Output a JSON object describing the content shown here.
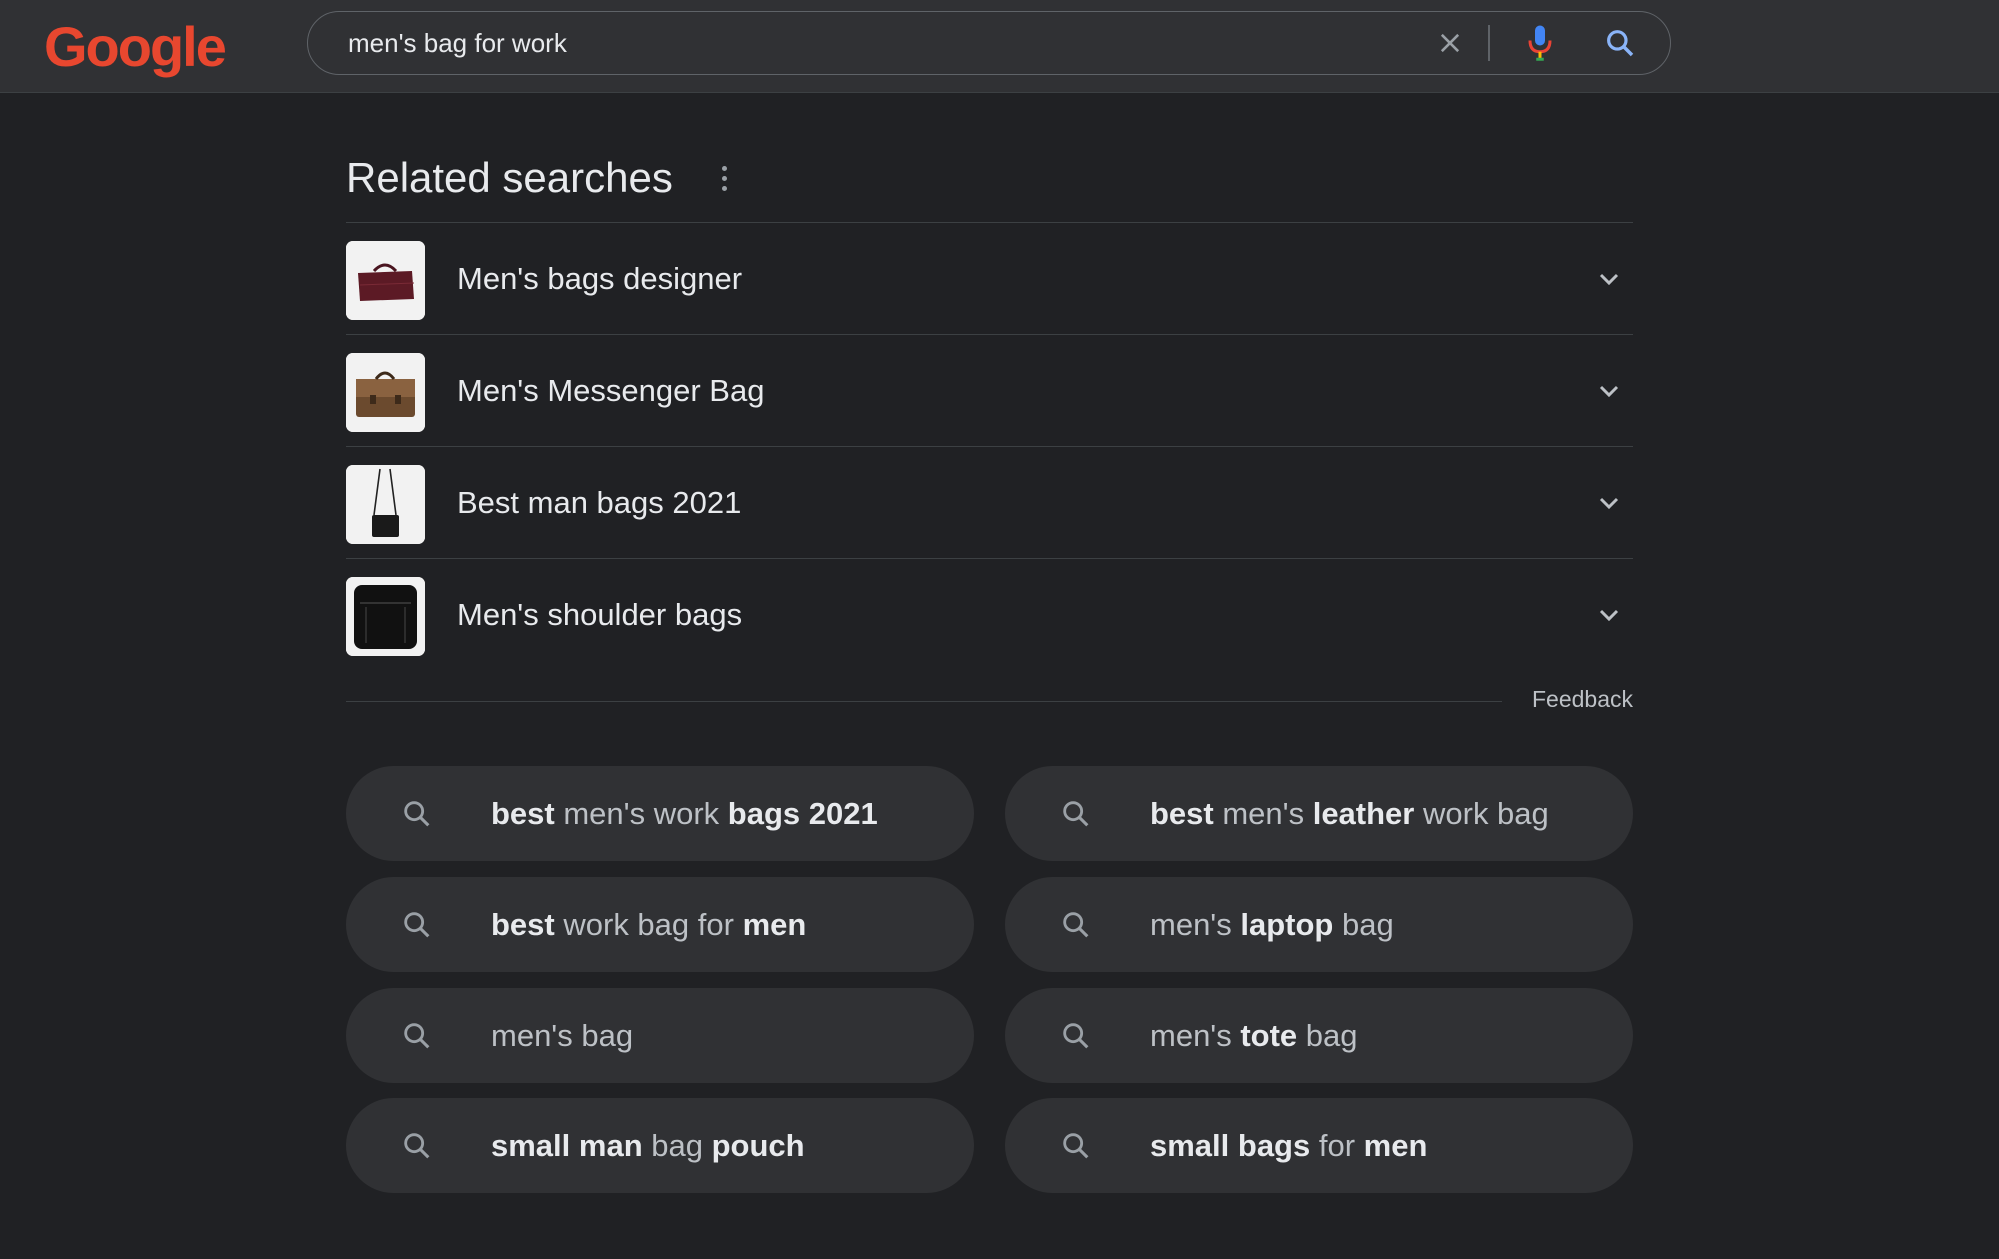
{
  "header": {
    "logo_text": "Google",
    "search_query": "men's bag for work",
    "icons": {
      "clear": "close-icon",
      "voice": "mic-icon",
      "search": "search-icon"
    }
  },
  "related": {
    "heading": "Related searches",
    "items": [
      {
        "label": "Men's bags designer",
        "thumb": "maroon-briefcase"
      },
      {
        "label": "Men's Messenger Bag",
        "thumb": "brown-messenger"
      },
      {
        "label": "Best man bags 2021",
        "thumb": "black-crossbody"
      },
      {
        "label": "Men's shoulder bags",
        "thumb": "black-shoulder-bag"
      }
    ],
    "feedback": "Feedback"
  },
  "chips": [
    {
      "parts": [
        {
          "t": "best",
          "b": true
        },
        {
          "t": " men's work ",
          "b": false
        },
        {
          "t": "bags 2021",
          "b": true
        }
      ]
    },
    {
      "parts": [
        {
          "t": "best",
          "b": true
        },
        {
          "t": " men's ",
          "b": false
        },
        {
          "t": "leather",
          "b": true
        },
        {
          "t": " work bag",
          "b": false
        }
      ]
    },
    {
      "parts": [
        {
          "t": "best",
          "b": true
        },
        {
          "t": " work bag for ",
          "b": false
        },
        {
          "t": "men",
          "b": true
        }
      ]
    },
    {
      "parts": [
        {
          "t": "men's ",
          "b": false
        },
        {
          "t": "laptop",
          "b": true
        },
        {
          "t": " bag",
          "b": false
        }
      ]
    },
    {
      "parts": [
        {
          "t": "men's bag",
          "b": false
        }
      ]
    },
    {
      "parts": [
        {
          "t": "men's ",
          "b": false
        },
        {
          "t": "tote",
          "b": true
        },
        {
          "t": " bag",
          "b": false
        }
      ]
    },
    {
      "parts": [
        {
          "t": "small man",
          "b": true
        },
        {
          "t": " bag ",
          "b": false
        },
        {
          "t": "pouch",
          "b": true
        }
      ]
    },
    {
      "parts": [
        {
          "t": "small bags",
          "b": true
        },
        {
          "t": " for ",
          "b": false
        },
        {
          "t": "men",
          "b": true
        }
      ]
    }
  ],
  "colors": {
    "background": "#202124",
    "topbar": "#303134",
    "chip": "#303134",
    "text": "#e8eaed",
    "muted": "#bdc1c6",
    "logo": "#e8472f"
  }
}
